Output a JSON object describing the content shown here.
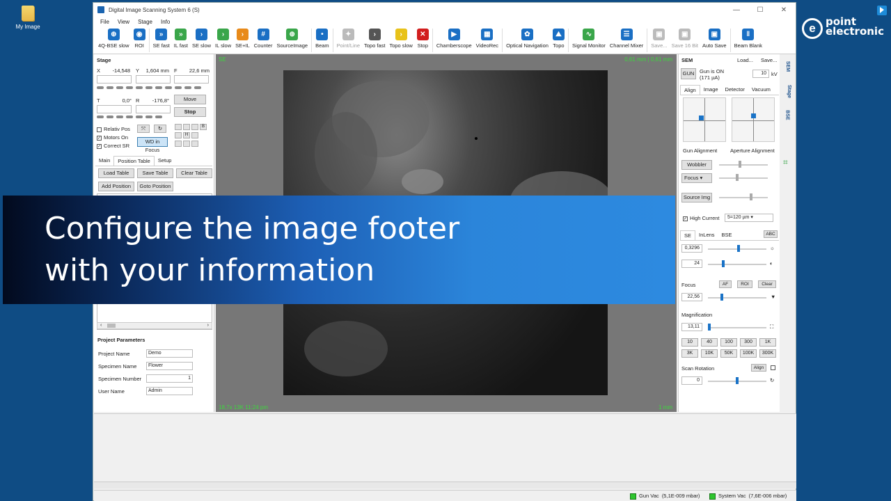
{
  "desktop": {
    "icon_label": "My Image"
  },
  "brand": {
    "line1": "point",
    "line2": "electronic"
  },
  "window": {
    "title": "Digital Image Scanning System 6 (S)",
    "minimize": "—",
    "maximize": "☐",
    "close": "✕"
  },
  "menu": [
    "File",
    "View",
    "Stage",
    "Info"
  ],
  "toolbar": [
    {
      "label": "4Q-BSE slow",
      "color": "#1a6fc4",
      "glyph": "⊕"
    },
    {
      "label": "ROI",
      "color": "#1a6fc4",
      "glyph": "◉"
    },
    {
      "label": "SE fast",
      "color": "#1a6fc4",
      "glyph": "»"
    },
    {
      "label": "IL fast",
      "color": "#3aa64a",
      "glyph": "»"
    },
    {
      "label": "SE slow",
      "color": "#1a6fc4",
      "glyph": "›"
    },
    {
      "label": "IL slow",
      "color": "#3aa64a",
      "glyph": "›"
    },
    {
      "label": "SE+IL",
      "color": "#e88a1a",
      "glyph": "›"
    },
    {
      "label": "Counter",
      "color": "#1a6fc4",
      "glyph": "#"
    },
    {
      "label": "SourceImage",
      "color": "#3aa64a",
      "glyph": "⊕"
    },
    {
      "label": "Beam",
      "color": "#1a6fc4",
      "glyph": "•"
    },
    {
      "label": "Point/Line",
      "color": "#bbbbbb",
      "glyph": "✦"
    },
    {
      "label": "Topo fast",
      "color": "#555555",
      "glyph": "›"
    },
    {
      "label": "Topo slow",
      "color": "#e8c21a",
      "glyph": "›"
    },
    {
      "label": "Stop",
      "color": "#d21e1e",
      "glyph": "✕"
    },
    {
      "label": "Chamberscope",
      "color": "#1a6fc4",
      "glyph": "▶"
    },
    {
      "label": "VideoRec",
      "color": "#1a6fc4",
      "glyph": "▦"
    },
    {
      "label": "Optical Navigation",
      "color": "#1a6fc4",
      "glyph": "✿"
    },
    {
      "label": "Topo",
      "color": "#1a6fc4",
      "glyph": "⛰"
    },
    {
      "label": "Signal Monitor",
      "color": "#3aa64a",
      "glyph": "∿"
    },
    {
      "label": "Channel Mixer",
      "color": "#1a6fc4",
      "glyph": "☰"
    },
    {
      "label": "Save...",
      "color": "#bbbbbb",
      "glyph": "▣"
    },
    {
      "label": "Save 16 Bit",
      "color": "#bbbbbb",
      "glyph": "▣"
    },
    {
      "label": "Auto Save",
      "color": "#1a6fc4",
      "glyph": "▣"
    },
    {
      "label": "Beam Blank",
      "color": "#1a6fc4",
      "glyph": "‖"
    }
  ],
  "stage": {
    "title": "Stage",
    "x_label": "X",
    "x_value": "-14,548 mm",
    "y_label": "Y",
    "y_value": "1,604 mm",
    "f_label": "F",
    "f_value": "22,6 mm",
    "t_label": "T",
    "t_value": "0,0°",
    "r_label": "R",
    "r_value": "-176,8°",
    "move": "Move",
    "stop": "Stop",
    "relativ_pos": "Relativ Pos",
    "motors_on": "Motors On",
    "correct_sr": "Correct SR",
    "wd_in_focus": "WD in Focus",
    "tabs": [
      "Main",
      "Position Table",
      "Setup"
    ],
    "load_table": "Load Table",
    "save_table": "Save Table",
    "clear_table": "Clear Table",
    "add_position": "Add Position",
    "goto_position": "Goto Position"
  },
  "project": {
    "title": "Project Parameters",
    "fields": [
      {
        "label": "Project Name",
        "value": "Demo"
      },
      {
        "label": "Specimen Name",
        "value": "Flower"
      },
      {
        "label": "Specimen Number",
        "value": "1"
      },
      {
        "label": "User Name",
        "value": "Admin"
      }
    ]
  },
  "image": {
    "overlay_tl": "SE",
    "overlay_tr": "0,61 mm | 0,61 mm",
    "overlay_bl": "18,7x 13K 11:24 pm",
    "overlay_br": "1 mm"
  },
  "sem": {
    "title": "SEM",
    "load": "Load...",
    "save": "Save...",
    "gun": "GUN",
    "gun_status": "Gun is ON",
    "gun_current": "(171 µA)",
    "kv_value": "10",
    "kv_unit": "kV",
    "tabs": [
      "Align",
      "Image",
      "Detector",
      "Vacuum"
    ],
    "gun_alignment": "Gun Alignment",
    "aperture_alignment": "Aperture Alignment",
    "wobbler": "Wobbler",
    "focus_select": "Focus",
    "source_img": "Source Img",
    "high_current": "High Current",
    "aperture_select": "5=120 µm",
    "detector_tabs": [
      "SE",
      "InLens",
      "BSE"
    ],
    "abc": "ABC",
    "contrast_value": "0,3296",
    "brightness_value": "24",
    "focus_label": "Focus",
    "af": "AF",
    "roi": "ROI",
    "clear": "Clear",
    "focus_value": "22,56",
    "magnification_label": "Magnification",
    "magnification_value": "13,11",
    "mag_buttons": [
      "10",
      "40",
      "100",
      "300",
      "1K",
      "3K",
      "10K",
      "50K",
      "100K",
      "300K"
    ],
    "scan_rotation_label": "Scan Rotation",
    "align": "Align",
    "scan_rotation_value": "0"
  },
  "side_tabs": [
    "SEM",
    "Stage",
    "BSE"
  ],
  "status": {
    "gun_vac_label": "Gun Vac",
    "gun_vac_value": "(5,1E-009 mbar)",
    "system_vac_label": "System Vac",
    "system_vac_value": "(7,6E-006 mbar)"
  },
  "banner": {
    "line1": "Configure the image footer",
    "line2": "with your information"
  }
}
